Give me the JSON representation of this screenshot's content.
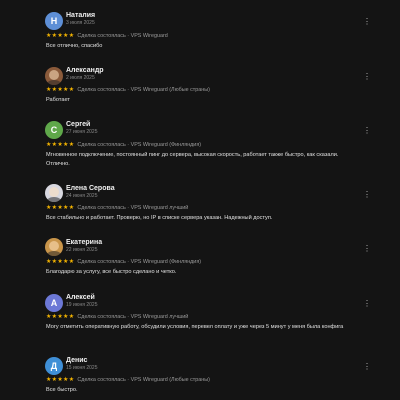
{
  "reviews": [
    {
      "author": "Наталия",
      "date": "3 июля 2025",
      "initial": "Н",
      "avatar_color": "#5e8fd6",
      "photo": false,
      "stars": "★★★★★",
      "deal": "Сделка состоялась · VPS Wireguard",
      "text": "Все отлично, спасибо"
    },
    {
      "author": "Александр",
      "date": "2 июля 2025",
      "initial": "",
      "avatar_color": "#8a5a3a",
      "photo": true,
      "stars": "★★★★★",
      "deal": "Сделка состоялась · VPS Wireguard (Любые страны)",
      "text": "Работает"
    },
    {
      "author": "Сергей",
      "date": "27 июня 2025",
      "initial": "С",
      "avatar_color": "#5fa84a",
      "photo": false,
      "stars": "★★★★★",
      "deal": "Сделка состоялась · VPS Wireguard (Финляндия)",
      "text": "Мгновенное подключение, постоянный пинг до сервера, высокая скорость, работает также быстро, как сказали. Отлично."
    },
    {
      "author": "Елена Серова",
      "date": "24 июня 2025",
      "initial": "",
      "avatar_color": "#d8d8e0",
      "photo": true,
      "stars": "★★★★★",
      "deal": "Сделка состоялась · VPS Wireguard лучший",
      "text": "Все стабильно и работает. Проверю, но IP в списке сервера указан. Надежный доступ."
    },
    {
      "author": "Екатерина",
      "date": "22 июня 2025",
      "initial": "",
      "avatar_color": "#c9954a",
      "photo": true,
      "stars": "★★★★★",
      "deal": "Сделка состоялась · VPS Wireguard (Финляндия)",
      "text": "Благодарю за услугу, все быстро сделано и четко."
    },
    {
      "author": "Алексей",
      "date": "19 июня 2025",
      "initial": "А",
      "avatar_color": "#6c78d6",
      "photo": false,
      "stars": "★★★★★",
      "deal": "Сделка состоялась · VPS Wireguard лучший",
      "text": "Могу отметить оперативную работу, обсудили условия, перевел оплату и уже через 5 минут у меня была конфига"
    },
    {
      "author": "Денис",
      "date": "15 июня 2025",
      "initial": "Д",
      "avatar_color": "#3f8fd6",
      "photo": false,
      "stars": "★★★★★",
      "deal": "Сделка состоялась · VPS Wireguard (Любые страны)",
      "text": "Все быстро."
    }
  ],
  "menu_glyph": "⋮"
}
